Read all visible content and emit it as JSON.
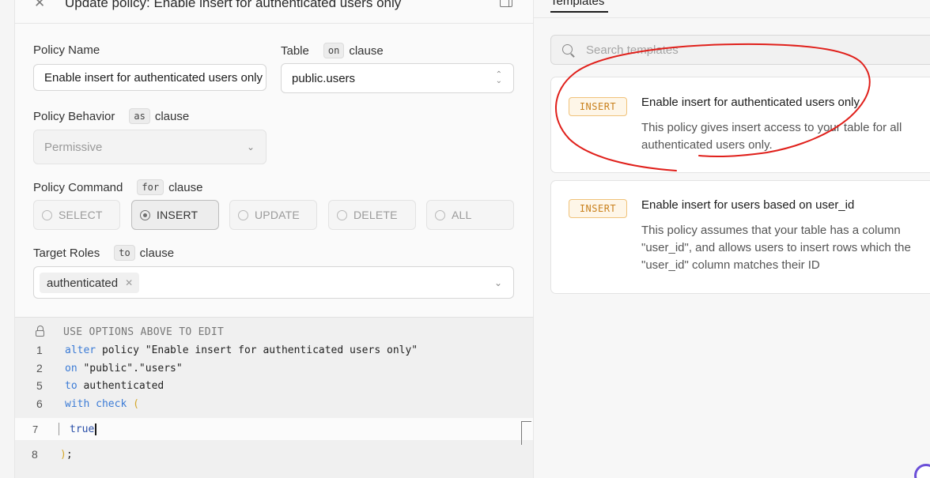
{
  "header": {
    "title": "Update policy: Enable insert for authenticated users only"
  },
  "form": {
    "policy_name": {
      "label": "Policy Name",
      "value": "Enable insert for authenticated users only"
    },
    "table": {
      "label": "Table",
      "keyword": "on",
      "suffix": "clause",
      "value": "public.users"
    },
    "behavior": {
      "label": "Policy Behavior",
      "keyword": "as",
      "suffix": "clause",
      "value": "Permissive"
    },
    "command": {
      "label": "Policy Command",
      "keyword": "for",
      "suffix": "clause",
      "options": [
        "SELECT",
        "INSERT",
        "UPDATE",
        "DELETE",
        "ALL"
      ],
      "selected": "INSERT"
    },
    "roles": {
      "label": "Target Roles",
      "keyword": "to",
      "suffix": "clause",
      "tags": [
        "authenticated"
      ]
    }
  },
  "editor": {
    "hint": "USE OPTIONS ABOVE TO EDIT",
    "lines": [
      {
        "num": "1",
        "kw": "alter",
        "rest": " policy \"Enable insert for authenticated users only\""
      },
      {
        "num": "2",
        "kw": "on",
        "rest": " \"public\".\"users\""
      },
      {
        "num": "5",
        "kw": "to",
        "rest": " authenticated"
      },
      {
        "num": "6",
        "kw": "with check",
        "paren": " ("
      }
    ],
    "line7": {
      "num": "7",
      "code": "true"
    },
    "line8": {
      "num": "8",
      "paren": ")",
      "rest": ";"
    }
  },
  "templates": {
    "tab_label": "Templates",
    "search_placeholder": "Search templates",
    "cards": [
      {
        "badge": "INSERT",
        "title": "Enable insert for authenticated users only",
        "description": "This policy gives insert access to your table for all authenticated users only."
      },
      {
        "badge": "INSERT",
        "title": "Enable insert for users based on user_id",
        "description": "This policy assumes that your table has a column \"user_id\", and allows users to insert rows which the \"user_id\" column matches their ID"
      }
    ]
  },
  "colors": {
    "keyword_blue": "#3b7bd6",
    "paren_yellow": "#d4a72c",
    "badge_orange": "#c9811d",
    "annotation_red": "#e0201b"
  }
}
